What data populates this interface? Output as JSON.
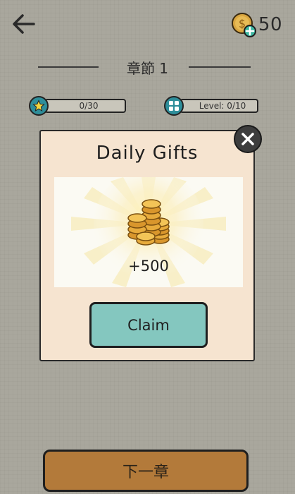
{
  "header": {
    "back_icon": "arrow-left-icon",
    "coin_icon": "coin-plus-icon",
    "coin_count": "50"
  },
  "chapter": {
    "title": "章節 1"
  },
  "stats": {
    "stars": {
      "icon": "star-icon",
      "value": "0/30"
    },
    "levels": {
      "icon": "grid-icon",
      "value": "Level: 0/10"
    }
  },
  "dialog": {
    "title": "Daily Gifts",
    "reward_icon": "coin-stack-icon",
    "reward_amount": "+500",
    "claim_label": "Claim",
    "close_icon": "close-icon"
  },
  "footer": {
    "next_chapter_label": "下一章"
  },
  "colors": {
    "background": "#a9a79d",
    "dialog_bg": "#f6e4d0",
    "claim_button": "#84c7bf",
    "next_button": "#b37a3a",
    "accent_teal": "#2e8e9a"
  }
}
